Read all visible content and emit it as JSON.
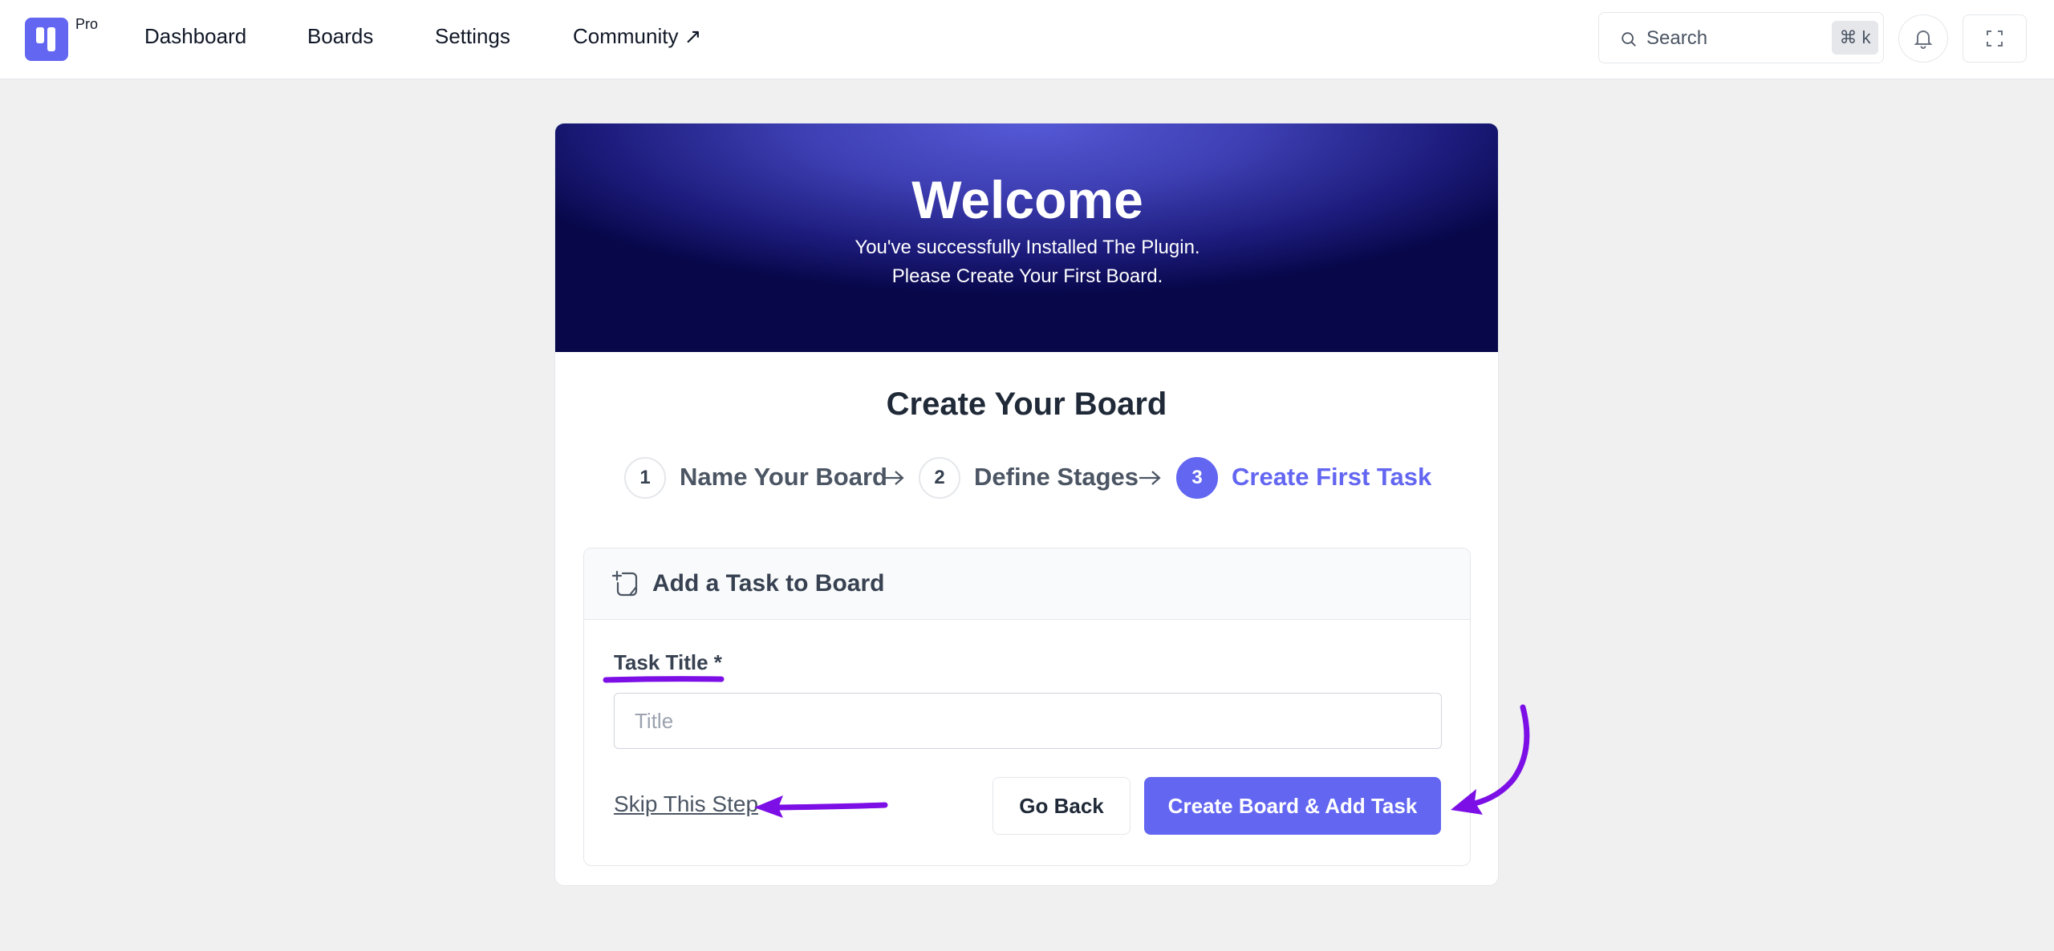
{
  "app": {
    "badge": "Pro"
  },
  "nav": {
    "items": [
      "Dashboard",
      "Boards",
      "Settings",
      "Community ↗"
    ]
  },
  "search": {
    "label": "Search",
    "shortcut": "⌘ k"
  },
  "hero": {
    "title": "Welcome",
    "line1": "You've successfully Installed The Plugin.",
    "line2": "Please Create Your First Board."
  },
  "wizard": {
    "title": "Create Your Board",
    "steps": [
      {
        "number": "1",
        "label": "Name Your Board"
      },
      {
        "number": "2",
        "label": "Define Stages"
      },
      {
        "number": "3",
        "label": "Create First Task"
      }
    ],
    "active_step": 3
  },
  "panel": {
    "title": "Add a Task to Board",
    "field_label": "Task Title *",
    "input_placeholder": "Title",
    "input_value": "",
    "skip_label": "Skip This Step",
    "back_label": "Go Back",
    "submit_label": "Create Board & Add Task"
  },
  "colors": {
    "accent": "#6366f1",
    "annotation": "#7c0fe6",
    "hero_dark": "#07074a"
  }
}
